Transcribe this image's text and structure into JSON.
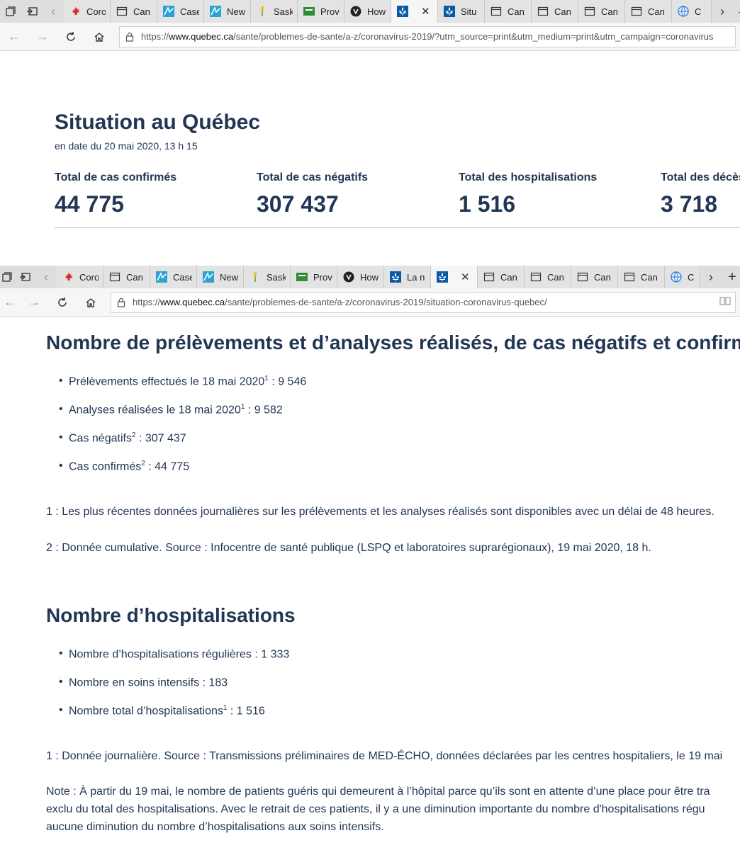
{
  "browser_top": {
    "tabs": [
      {
        "label": "Coro",
        "icon": "maple-leaf-icon",
        "active": false
      },
      {
        "label": "Can",
        "icon": "page-icon",
        "active": false
      },
      {
        "label": "Case",
        "icon": "chart-icon",
        "active": false
      },
      {
        "label": "New",
        "icon": "chart-icon",
        "active": false
      },
      {
        "label": "Sask",
        "icon": "wheat-icon",
        "active": false
      },
      {
        "label": "Prov",
        "icon": "green-flag-icon",
        "active": false
      },
      {
        "label": "How",
        "icon": "shield-icon",
        "active": false
      },
      {
        "label": "",
        "icon": "fleur-de-lis-icon",
        "active": true
      },
      {
        "label": "Situ",
        "icon": "fleur-de-lis-icon",
        "active": false
      },
      {
        "label": "Can",
        "icon": "page-icon",
        "active": false
      },
      {
        "label": "Can",
        "icon": "page-icon",
        "active": false
      },
      {
        "label": "Can",
        "icon": "page-icon",
        "active": false
      },
      {
        "label": "Can",
        "icon": "page-icon",
        "active": false
      },
      {
        "label": "C",
        "icon": "globe-icon",
        "active": false
      }
    ],
    "url_prefix": "https://",
    "url_domain": "www.quebec.ca",
    "url_path": "/sante/problemes-de-sante/a-z/coronavirus-2019/?utm_source=print&utm_medium=print&utm_campaign=coronavirus"
  },
  "browser_bottom": {
    "tabs": [
      {
        "label": "Coro",
        "icon": "maple-leaf-icon",
        "active": false
      },
      {
        "label": "Can",
        "icon": "page-icon",
        "active": false
      },
      {
        "label": "Case",
        "icon": "chart-icon",
        "active": false
      },
      {
        "label": "New",
        "icon": "chart-icon",
        "active": false
      },
      {
        "label": "Sask",
        "icon": "wheat-icon",
        "active": false
      },
      {
        "label": "Prov",
        "icon": "green-flag-icon",
        "active": false
      },
      {
        "label": "How",
        "icon": "shield-icon",
        "active": false
      },
      {
        "label": "La n",
        "icon": "fleur-de-lis-icon",
        "active": false
      },
      {
        "label": "",
        "icon": "fleur-de-lis-icon",
        "active": true
      },
      {
        "label": "Can",
        "icon": "page-icon",
        "active": false
      },
      {
        "label": "Can",
        "icon": "page-icon",
        "active": false
      },
      {
        "label": "Can",
        "icon": "page-icon",
        "active": false
      },
      {
        "label": "Can",
        "icon": "page-icon",
        "active": false
      },
      {
        "label": "C",
        "icon": "globe-icon",
        "active": false
      }
    ],
    "url_prefix": "https://",
    "url_domain": "www.quebec.ca",
    "url_path": "/sante/problemes-de-sante/a-z/coronavirus-2019/situation-coronavirus-quebec/"
  },
  "situation": {
    "title": "Situation au Québec",
    "date": "en date du 20 mai 2020, 13 h 15",
    "stats": [
      {
        "label": "Total de cas confirmés",
        "value": "44 775"
      },
      {
        "label": "Total de cas négatifs",
        "value": "307 437"
      },
      {
        "label": "Total des hospitalisations",
        "value": "1 516"
      },
      {
        "label": "Total des décès",
        "value": "3 718"
      }
    ]
  },
  "tests": {
    "heading": "Nombre de prélèvements et d’analyses réalisés, de cas négatifs et confirmés",
    "items": [
      {
        "text": "Prélèvements effectués le 18 mai 2020",
        "sup": "1",
        "value": " : 9 546"
      },
      {
        "text": "Analyses réalisées le 18 mai 2020",
        "sup": "1",
        "value": " : 9 582"
      },
      {
        "text": "Cas négatifs",
        "sup": "2",
        "value": " : 307 437"
      },
      {
        "text": "Cas confirmés",
        "sup": "2",
        "value": " : 44 775"
      }
    ],
    "note1": "1 : Les plus récentes données journalières sur les prélèvements et les analyses réalisés sont disponibles avec un délai de 48 heures.",
    "note2": "2 : Donnée cumulative. Source : Infocentre de santé publique (LSPQ et laboratoires suprarégionaux), 19 mai 2020, 18 h."
  },
  "hosp": {
    "heading": "Nombre d’hospitalisations",
    "items": [
      {
        "text": "Nombre d’hospitalisations régulières",
        "sup": "",
        "value": " : 1 333"
      },
      {
        "text": "Nombre en soins intensifs",
        "sup": "",
        "value": " : 183"
      },
      {
        "text": "Nombre total d’hospitalisations",
        "sup": "1",
        "value": " : 1 516"
      }
    ],
    "note1": "1 : Donnée journalière. Source : Transmissions préliminaires de MED-ÉCHO, données déclarées par les centres hospitaliers, le 19 mai",
    "note_line1": "Note : À partir du 19 mai, le nombre de patients guéris qui demeurent à l’hôpital parce qu’ils sont en attente d’une place pour être tra",
    "note_line2": "exclu du total des hospitalisations. Avec le retrait de ces patients, il y a une diminution importante du nombre d'hospitalisations régu",
    "note_line3": "aucune diminution du nombre d’hospitalisations aux soins intensifs."
  }
}
